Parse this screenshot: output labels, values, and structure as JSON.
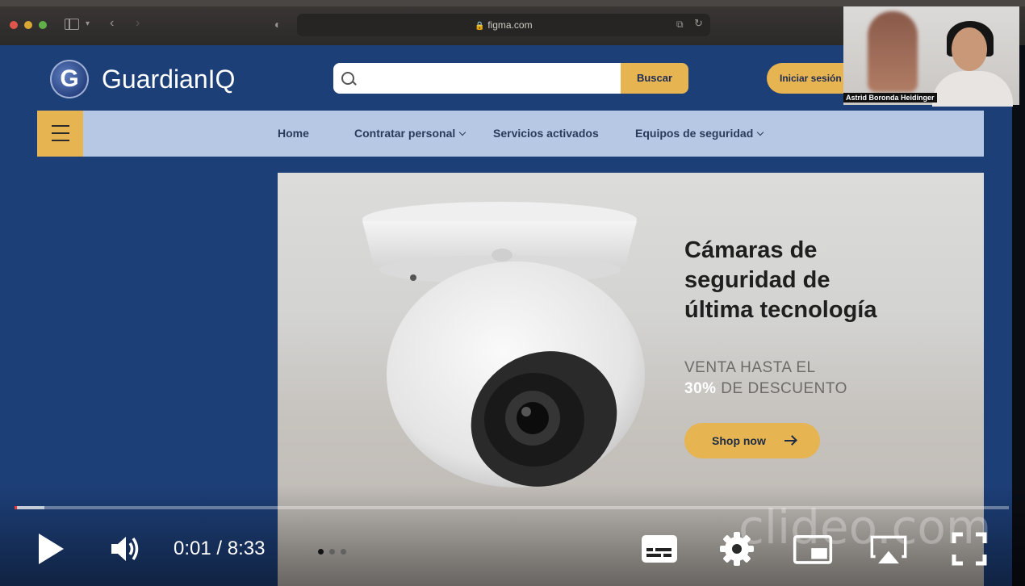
{
  "browser": {
    "url": "figma.com"
  },
  "site": {
    "brand": "GuardianIQ",
    "logo_letter": "G",
    "search": {
      "placeholder": "",
      "button_label": "Buscar"
    },
    "login_label": "Iniciar sesión",
    "nav": {
      "items": [
        {
          "label": "Home",
          "has_dropdown": false
        },
        {
          "label": "Contratar personal",
          "has_dropdown": true
        },
        {
          "label": "Servicios activados",
          "has_dropdown": false
        },
        {
          "label": "Equipos de seguridad",
          "has_dropdown": true
        }
      ]
    },
    "hero": {
      "title_lines": [
        "Cámaras de",
        "seguridad de",
        "última tecnología"
      ],
      "subtitle_line1": "VENTA HASTA EL",
      "discount": "30%",
      "subtitle_line2_rest": " DE DESCUENTO",
      "cta_label": "Shop now",
      "slides": {
        "count": 3,
        "active": 1
      }
    }
  },
  "webcam": {
    "participant_name": "Astrid Boronda Heidinger"
  },
  "player": {
    "current_time": "0:01",
    "separator": " / ",
    "duration": "8:33",
    "played_fraction": 0.002,
    "buffered_fraction": 0.03,
    "watermark": "clideo.com"
  },
  "colors": {
    "site_bg": "#1d3f78",
    "accent": "#e6b451",
    "nav_bg": "#b6c8e3",
    "progress_played": "#e53935"
  }
}
